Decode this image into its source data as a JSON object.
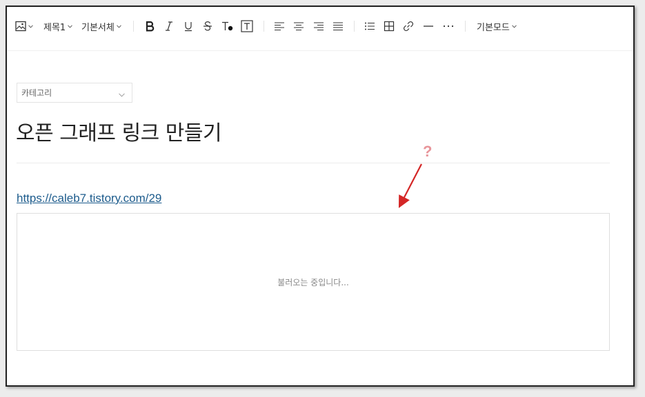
{
  "toolbar": {
    "heading_label": "제목1",
    "font_label": "기본서체",
    "mode_label": "기본모드",
    "icons": [
      "image-icon",
      "bold-icon",
      "italic-icon",
      "underline-icon",
      "strikethrough-icon",
      "text-color-icon",
      "text-background-icon",
      "align-left-icon",
      "align-center-icon",
      "align-right-icon",
      "align-justify-icon",
      "list-icon",
      "table-icon",
      "link-icon",
      "horizontal-rule-icon",
      "more-icon"
    ]
  },
  "editor": {
    "category_placeholder": "카테고리",
    "title": "오픈 그래프 링크 만들기",
    "link_url": "https://caleb7.tistory.com/29",
    "preview_loading_text": "불러오는 중입니다..."
  },
  "annotation": {
    "question_mark": "?",
    "color": "#e8959a",
    "arrow_color": "#d42626"
  }
}
